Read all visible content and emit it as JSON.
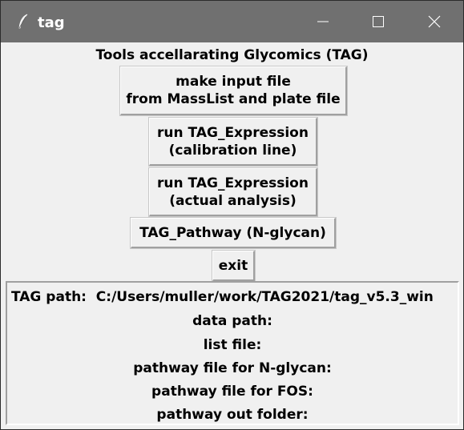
{
  "window": {
    "title": "tag",
    "titlebar_color": "#707070"
  },
  "heading": "Tools accellarating Glycomics (TAG)",
  "buttons": {
    "make_input": [
      "make input file",
      "from MassList and plate file"
    ],
    "expr_cal": [
      "run TAG_Expression",
      "(calibration line)"
    ],
    "expr_actual": [
      "run TAG_Expression",
      "(actual analysis)"
    ],
    "pathway": "TAG_Pathway (N-glycan)",
    "exit": "exit"
  },
  "info": {
    "tag_path": "TAG path:  C:/Users/muller/work/TAG2021/tag_v5.3_win",
    "data_path": "data path:",
    "list_file": "list file:",
    "pathway_nglycan": "pathway file for N-glycan:",
    "pathway_fos": "pathway file for FOS:",
    "pathway_out": "pathway out folder:"
  }
}
